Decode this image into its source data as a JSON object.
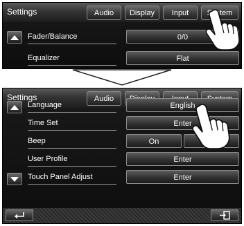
{
  "screen1": {
    "title": "Settings",
    "tabs": [
      "Audio",
      "Display",
      "Input",
      "System"
    ],
    "rows": [
      {
        "label": "Fader/Balance",
        "value": "0/0"
      },
      {
        "label": "Equalizer",
        "value": "Flat"
      }
    ]
  },
  "screen2": {
    "title": "Settings",
    "tabs": [
      "Audio",
      "Display",
      "Input",
      "System"
    ],
    "rows": [
      {
        "label": "Language",
        "value": "English"
      },
      {
        "label": "Time Set",
        "value": "Enter"
      },
      {
        "label": "Beep",
        "value": "On",
        "value2": "Off"
      },
      {
        "label": "User Profile",
        "value": "Enter"
      },
      {
        "label": "Touch Panel Adjust",
        "value": "Enter"
      }
    ],
    "footer": {
      "back_icon": "return-arrow-icon",
      "exit_icon": "exit-icon"
    }
  },
  "icons": {
    "pointer": "pointing-hand-icon",
    "transition": "down-arrow-icon"
  }
}
